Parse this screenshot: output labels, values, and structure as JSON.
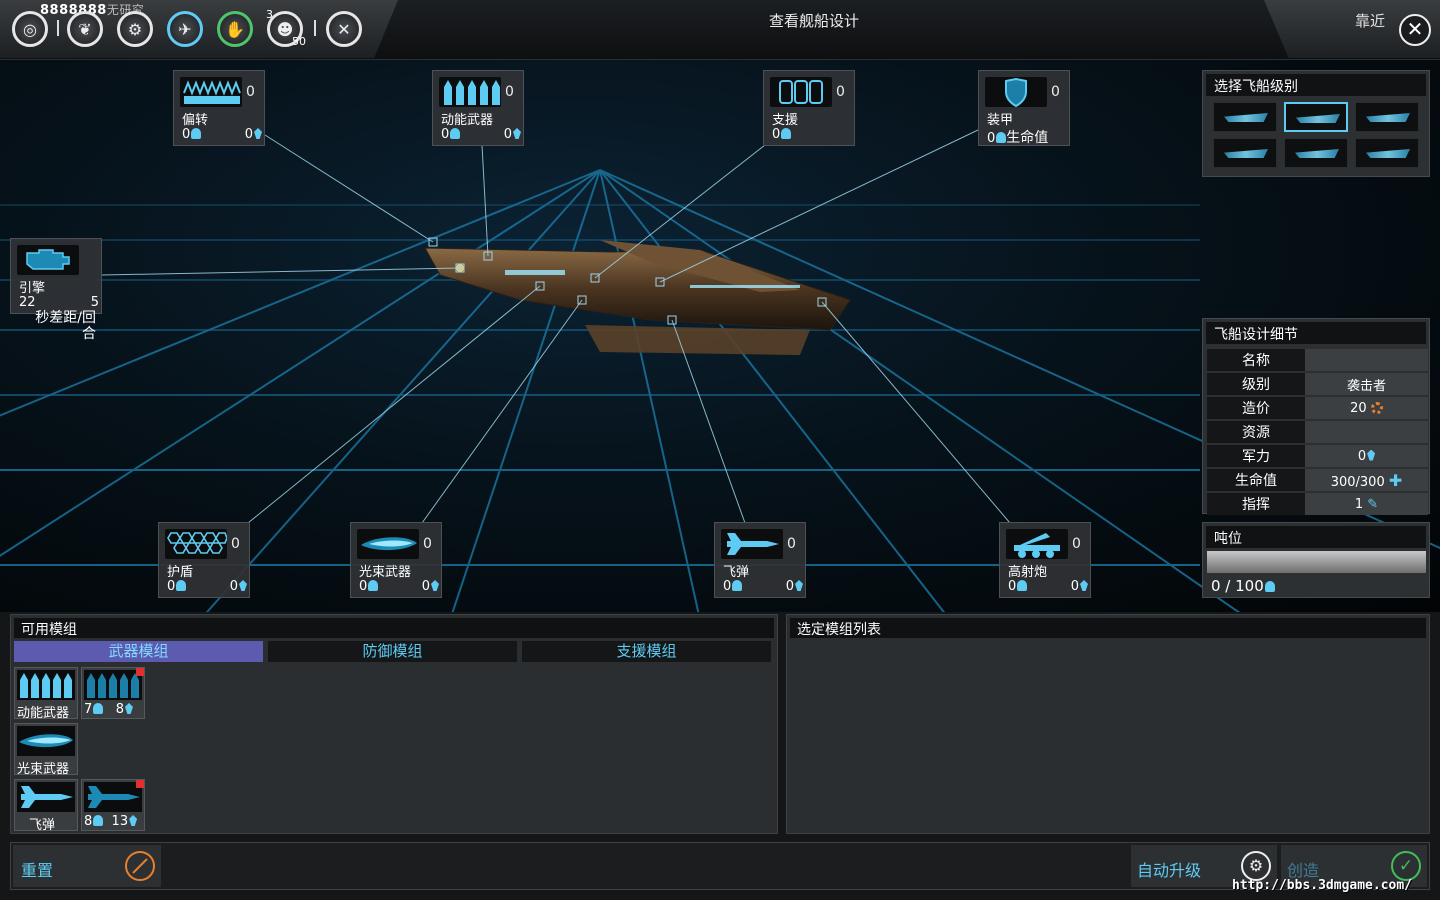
{
  "topbar": {
    "resource_value": "8888888",
    "resource_sub": "无研究",
    "badge_3": "3",
    "badge_50": "50",
    "page_title": "查看舰船设计",
    "zoom_label": "靠近",
    "close_symbol": "✕",
    "icons": [
      "research-icon",
      "laurel-icon",
      "production-icon",
      "fleet-icon",
      "diplomacy-icon",
      "population-icon",
      "tools-icon"
    ]
  },
  "slots": {
    "deflect": {
      "name": "偏转",
      "count": "0",
      "crew": "0",
      "power": "0"
    },
    "kinetic": {
      "name": "动能武器",
      "count": "0",
      "crew": "0",
      "power": "0"
    },
    "support": {
      "name": "支援",
      "count": "0",
      "crew": "0"
    },
    "armor": {
      "name": "装甲",
      "count": "0",
      "crew": "0",
      "hp_label": "生命值"
    },
    "engine": {
      "name": "引擎",
      "v1": "22",
      "v2": "5",
      "unit": "秒差距/回合"
    },
    "shield": {
      "name": "护盾",
      "count": "0",
      "crew": "0",
      "power": "0"
    },
    "beam": {
      "name": "光束武器",
      "count": "0",
      "crew": "0",
      "power": "0"
    },
    "missile": {
      "name": "飞弹",
      "count": "0",
      "crew": "0",
      "power": "0"
    },
    "artillery": {
      "name": "高射炮",
      "count": "0",
      "crew": "0",
      "power": "0"
    }
  },
  "shipclass": {
    "title": "选择飞船级别",
    "selected_index": 1,
    "thumbs": [
      "ship-class-1",
      "ship-class-2",
      "ship-class-3",
      "ship-class-4",
      "ship-class-5",
      "ship-class-6"
    ]
  },
  "details": {
    "title": "飞船设计细节",
    "rows": [
      {
        "k": "名称",
        "v": ""
      },
      {
        "k": "级别",
        "v": "袭击者"
      },
      {
        "k": "造价",
        "v": "20"
      },
      {
        "k": "资源",
        "v": ""
      },
      {
        "k": "军力",
        "v": "0"
      },
      {
        "k": "生命值",
        "v": "300/300"
      },
      {
        "k": "指挥",
        "v": "1"
      }
    ]
  },
  "tonnage": {
    "title": "吨位",
    "value": "0 / 100"
  },
  "modules": {
    "title": "可用模组",
    "tabs": [
      "武器模组",
      "防御模组",
      "支援模组"
    ],
    "items": [
      {
        "label": "动能武器"
      },
      {
        "label": "",
        "crew": "7",
        "power": "8"
      },
      {
        "label": "光束武器"
      },
      {
        "label": "飞弹"
      },
      {
        "label": "",
        "crew": "8",
        "power": "13"
      }
    ]
  },
  "selected": {
    "title": "选定模组列表"
  },
  "buttons": {
    "reset": "重置",
    "auto_upgrade": "自动升级",
    "create": "创造"
  },
  "watermark": "http://bbs.3dmgame.com/",
  "colors": {
    "accent": "#5ecbf2",
    "tab_active": "#5d5bb0",
    "cost": "#e8802b",
    "badge_red": "#e23030",
    "create_ok": "#3fbf5a"
  }
}
